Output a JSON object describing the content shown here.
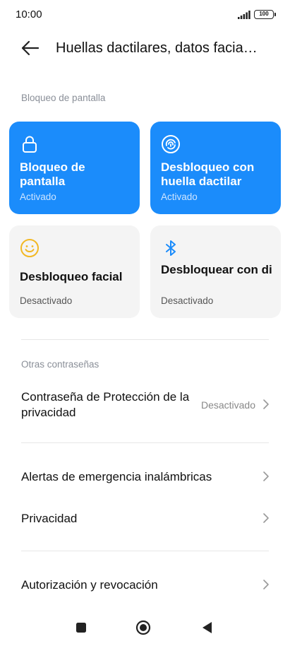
{
  "status_bar": {
    "time": "10:00",
    "battery": "100"
  },
  "header": {
    "title": "Huellas dactilares, datos facia…"
  },
  "screen_lock_section": {
    "label": "Bloqueo de pantalla",
    "tiles": [
      {
        "title": "Bloqueo de pantalla",
        "status": "Activado",
        "icon": "lock-icon"
      },
      {
        "title": "Desbloqueo con huella dactilar",
        "status": "Activado",
        "icon": "fingerprint-icon"
      },
      {
        "title": "Desbloqueo facial",
        "status": "Desactivado",
        "icon": "smiley-face-icon"
      },
      {
        "title": "Desbloquear con dispositivo …",
        "status": "Desactivado",
        "icon": "bluetooth-icon"
      }
    ]
  },
  "other_passwords_section": {
    "label": "Otras contraseñas",
    "privacy_protection": {
      "label": "Contraseña de Protección de la privacidad",
      "value": "Desactivado"
    }
  },
  "rows": {
    "emergency_alerts": "Alertas de emergencia inalámbricas",
    "privacy": "Privacidad",
    "authorization": "Autorización y revocación"
  },
  "colors": {
    "accent": "#1b8cfb",
    "tile_inactive": "#f4f4f4",
    "face_icon": "#f2b824",
    "bluetooth_icon": "#1b8cfb"
  }
}
